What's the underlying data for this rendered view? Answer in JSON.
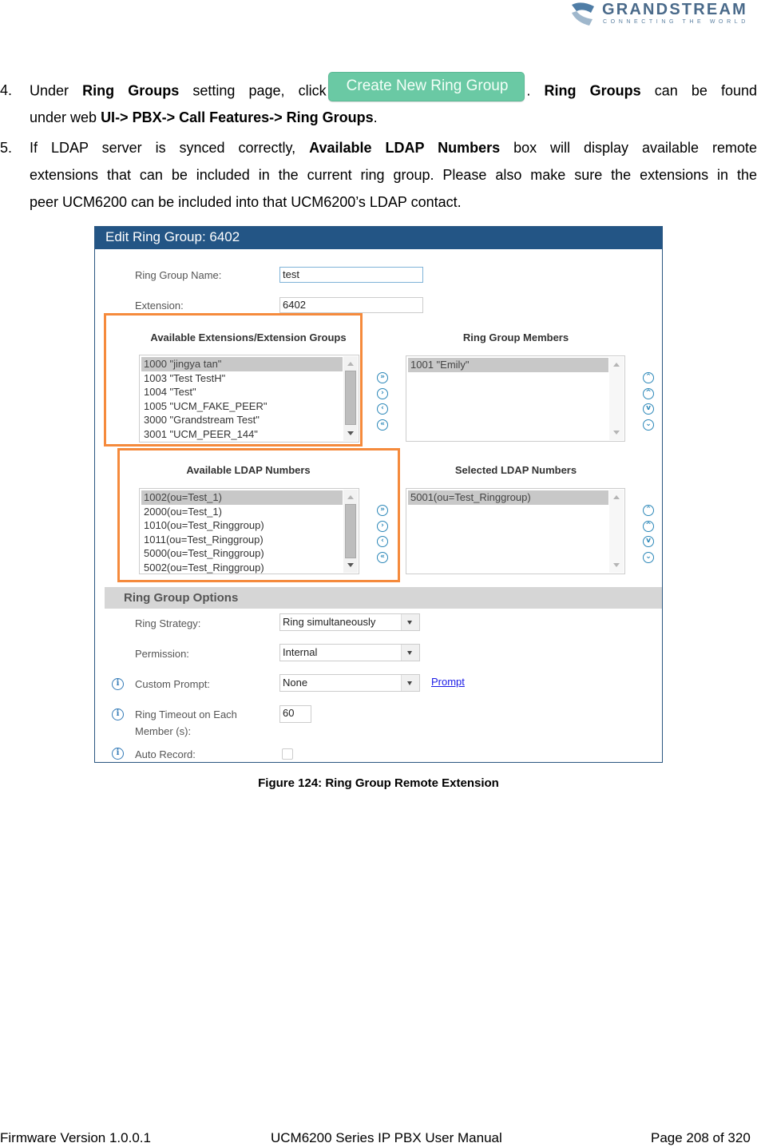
{
  "logo": {
    "wordmark": "GRANDSTREAM",
    "tagline": "CONNECTING THE WORLD"
  },
  "steps": [
    {
      "number": "4.",
      "t1": "Under ",
      "b1": "Ring Groups",
      "t2": " setting page, click",
      "button_label": "Create New Ring Group",
      "t3": ". ",
      "b2": "Ring Groups",
      "t4": " can be found",
      "t5": "under web ",
      "b3": "UI-> PBX-> Call Features-> Ring Groups",
      "t6": "."
    },
    {
      "number": "5.",
      "t1": "If LDAP server is synced correctly, ",
      "b1": "Available LDAP Numbers",
      "t2": " box will display available remote",
      "line2": "extensions that can be included in the current ring group. Please also make sure the extensions in the",
      "line3": "peer UCM6200 can be included into that UCM6200’s LDAP contact."
    }
  ],
  "figure": {
    "title": "Edit Ring Group: 6402",
    "fields": {
      "name_label": "Ring Group Name:",
      "name_value": "test",
      "extension_label": "Extension:",
      "extension_value": "6402"
    },
    "available_extensions": {
      "title": "Available Extensions/Extension Groups",
      "items": [
        "1000 \"jingya tan\"",
        "1003 \"Test TestH\"",
        "1004 \"Test\"",
        "1005 \"UCM_FAKE_PEER\"",
        "3000 \"Grandstream Test\"",
        "3001 \"UCM_PEER_144\""
      ],
      "selected_index": 0
    },
    "ring_group_members": {
      "title": "Ring Group Members",
      "items": [
        "1001 \"Emily\""
      ],
      "selected_index": 0
    },
    "available_ldap": {
      "title": "Available LDAP Numbers",
      "items": [
        "1002(ou=Test_1)",
        "2000(ou=Test_1)",
        "1010(ou=Test_Ringgroup)",
        "1011(ou=Test_Ringgroup)",
        "5000(ou=Test_Ringgroup)",
        "5002(ou=Test_Ringgroup)"
      ],
      "selected_index": 0
    },
    "selected_ldap": {
      "title": "Selected LDAP Numbers",
      "items": [
        "5001(ou=Test_Ringgroup)"
      ],
      "selected_index": 0
    },
    "transfer_icons": [
      "move-all-right-icon",
      "move-right-icon",
      "move-left-icon",
      "move-all-left-icon"
    ],
    "order_icons": [
      "move-top-icon",
      "move-up-icon",
      "move-down-icon",
      "move-bottom-icon"
    ],
    "options": {
      "section_title": "Ring Group Options",
      "ring_strategy_label": "Ring Strategy:",
      "ring_strategy_value": "Ring simultaneously",
      "permission_label": "Permission:",
      "permission_value": "Internal",
      "custom_prompt_label": "Custom Prompt:",
      "custom_prompt_value": "None",
      "prompt_link": "Prompt",
      "ring_timeout_label_1": "Ring Timeout on Each",
      "ring_timeout_label_2": "Member (s):",
      "ring_timeout_value": "60",
      "auto_record_label": "Auto Record:",
      "auto_record_checked": false
    }
  },
  "caption": "Figure 124: Ring Group Remote Extension",
  "footer": {
    "left": "Firmware Version 1.0.0.1",
    "center": "UCM6200 Series IP PBX User Manual",
    "right": "Page 208 of 320"
  },
  "colors": {
    "header_bg": "#235585",
    "highlight_border": "#f58a3c",
    "create_button": "#6ac9a4",
    "icon_blue": "#2b87b8"
  }
}
